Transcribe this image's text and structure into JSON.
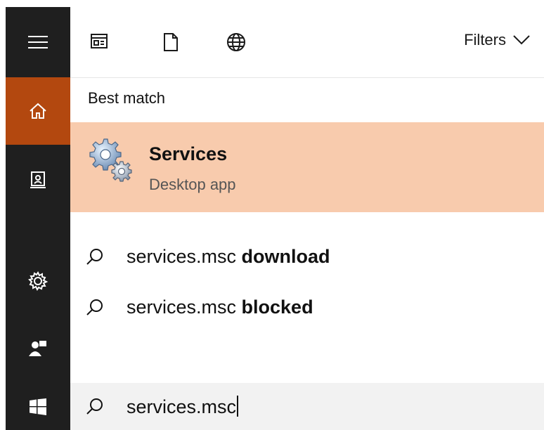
{
  "toolbar": {
    "icons": [
      "apps-icon",
      "documents-icon",
      "web-icon"
    ],
    "filters_label": "Filters"
  },
  "rail": {
    "items": [
      "hamburger-menu-icon",
      "home-icon",
      "device-icon",
      "settings-icon",
      "user-icon",
      "windows-start-icon"
    ],
    "active": "home-icon"
  },
  "results": {
    "section_title": "Best match",
    "best_match": {
      "name": "Services",
      "type": "Desktop app",
      "icon": "services-gears-icon"
    },
    "suggestions": [
      {
        "query": "services.msc",
        "completion": "download"
      },
      {
        "query": "services.msc",
        "completion": "blocked"
      }
    ]
  },
  "search": {
    "value": "services.msc"
  },
  "colors": {
    "accent": "#b3480f",
    "selection": "#f8cbad",
    "rail": "#1f1f1f",
    "searchbox": "#f2f2f2"
  }
}
